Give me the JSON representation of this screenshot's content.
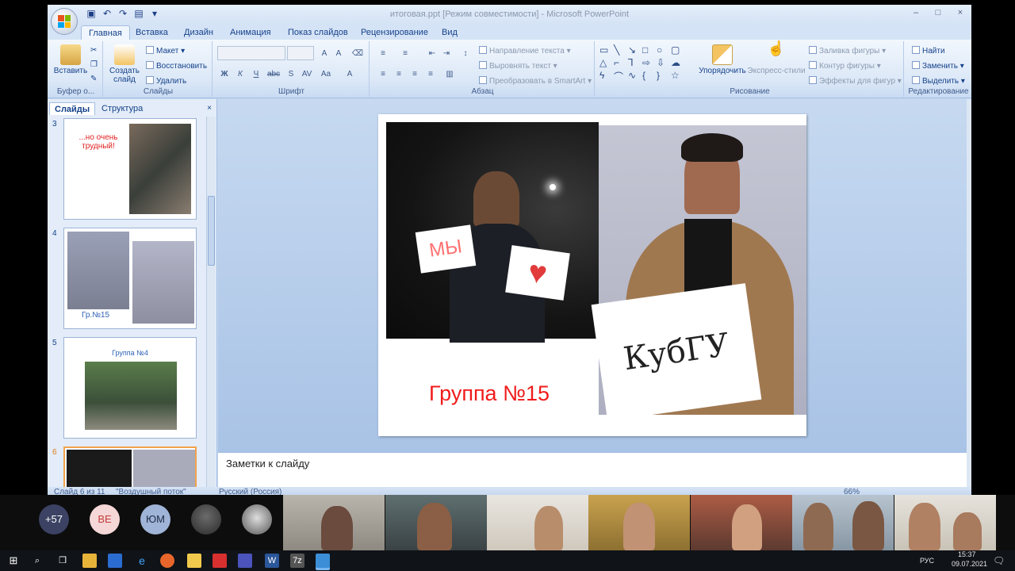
{
  "window": {
    "title": "итоговая.ppt [Режим совместимости] - Microsoft PowerPoint",
    "controls": [
      "–",
      "□",
      "×"
    ]
  },
  "tabs": [
    "Главная",
    "Вставка",
    "Дизайн",
    "Анимация",
    "Показ слайдов",
    "Рецензирование",
    "Вид"
  ],
  "ribbon": {
    "clipboard": {
      "paste": "Вставить",
      "label": "Буфер о..."
    },
    "slides": {
      "create": "Создать слайд",
      "layout": "Макет",
      "reset": "Восстановить",
      "delete": "Удалить",
      "label": "Слайды"
    },
    "font": {
      "label": "Шрифт",
      "buttons": [
        "Ж",
        "К",
        "Ч",
        "abc",
        "S",
        "AV",
        "Aa",
        "A"
      ]
    },
    "paragraph": {
      "text_direction": "Направление текста",
      "align_text": "Выровнять текст",
      "convert_smartart": "Преобразовать в SmartArt",
      "label": "Абзац"
    },
    "drawing": {
      "arrange": "Упорядочить",
      "quick_styles": "Экспресс-стили",
      "shape_fill": "Заливка фигуры",
      "shape_outline": "Контур фигуры",
      "shape_effects": "Эффекты для фигур",
      "label": "Рисование"
    },
    "editing": {
      "find": "Найти",
      "replace": "Заменить",
      "select": "Выделить",
      "label": "Редактирование"
    }
  },
  "panel": {
    "tab_slides": "Слайды",
    "tab_outline": "Структура",
    "close": "×",
    "thumbs": [
      {
        "num": "3",
        "text": "...но очень трудный!"
      },
      {
        "num": "4",
        "text": "Гр.№15"
      },
      {
        "num": "5",
        "text": "Группа №4"
      },
      {
        "num": "6",
        "text": ""
      }
    ]
  },
  "slide": {
    "caption": "Группа №15",
    "sign_left_1": "МЫ",
    "sign_right": "КубГУ"
  },
  "notes": {
    "placeholder": "Заметки к слайду"
  },
  "status": {
    "slide": "Слайд 6 из 11",
    "theme": "\"Воздушный поток\"",
    "lang": "Русский (Россия)",
    "zoom": "66%"
  },
  "call": {
    "more": "+57",
    "participants": [
      "ВЕ",
      "ЮМ"
    ],
    "colors": {
      "more": "#3b4263",
      "ve": "#f5d7d7",
      "um": "#9fb4d6"
    }
  },
  "taskbar": {
    "lang": "РУС",
    "time": "15:37",
    "date": "09.07.2021"
  }
}
